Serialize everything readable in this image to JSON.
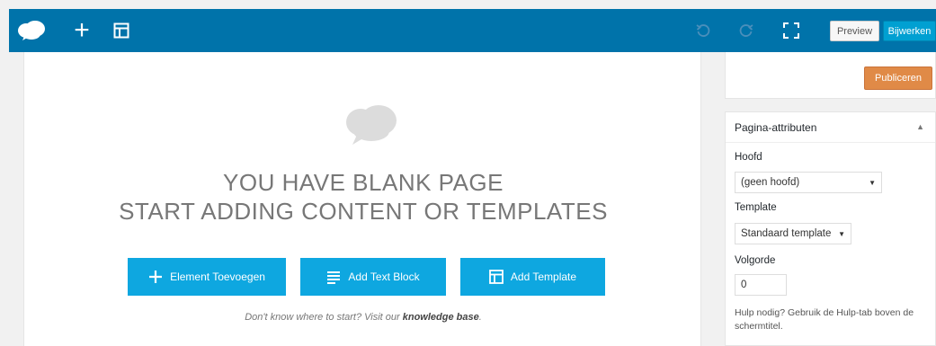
{
  "toolbar": {
    "logo_icon": "cloud-icon",
    "add_icon": "plus-icon",
    "layout_icon": "layout-icon",
    "undo_icon": "undo-icon",
    "redo_icon": "redo-icon",
    "fullscreen_icon": "fullscreen-icon",
    "preview_label": "Preview",
    "update_label": "Bijwerken",
    "bg_color": "#0073aa"
  },
  "canvas": {
    "title": "YOU HAVE BLANK PAGE",
    "subtitle": "START ADDING CONTENT OR TEMPLATES",
    "buttons": [
      {
        "label": "Element Toevoegen",
        "icon": "plus-icon"
      },
      {
        "label": "Add Text Block",
        "icon": "text-lines-icon"
      },
      {
        "label": "Add Template",
        "icon": "template-icon"
      }
    ],
    "hint_prefix": "Don't know where to start? Visit our",
    "hint_link": "knowledge base",
    "hint_suffix": ".",
    "button_color": "#0ea7e0"
  },
  "sidebar": {
    "publish_label": "Publiceren",
    "publish_color": "#e08a47",
    "attributes": {
      "title": "Pagina-attributen",
      "toggle_icon": "triangle-up-icon",
      "parent_label": "Hoofd",
      "parent_value": "(geen hoofd)",
      "template_label": "Template",
      "template_value": "Standaard template",
      "order_label": "Volgorde",
      "order_value": "0",
      "help_text": "Hulp nodig? Gebruik de Hulp-tab boven de schermtitel."
    }
  }
}
